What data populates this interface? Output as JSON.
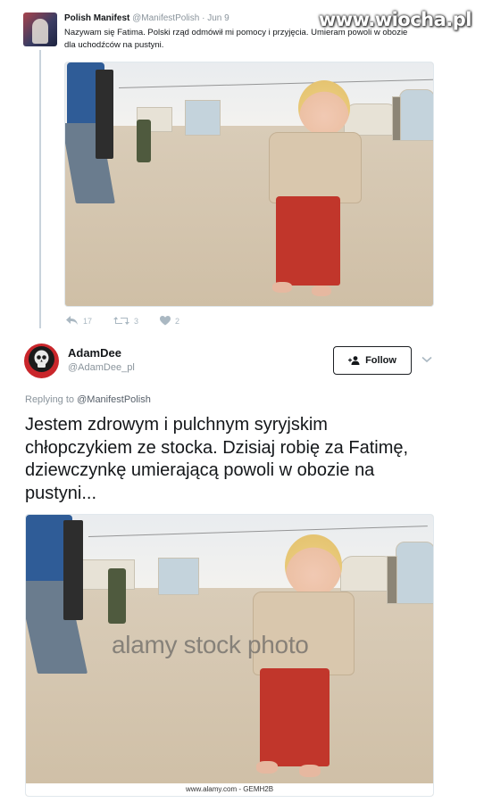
{
  "watermark": "www.wiocha.pl",
  "quoted_tweet": {
    "name": "Polish Manifest",
    "handle": "@ManifestPolish",
    "separator": "·",
    "date": "Jun 9",
    "text": "Nazywam się Fatima. Polski rząd odmówił mi pomocy i przyjęcia. Umieram powoli w obozie dla uchodźców na pustyni.",
    "actions": {
      "reply_count": "17",
      "retweet_count": "3",
      "like_count": "2"
    }
  },
  "main_tweet": {
    "name": "AdamDee",
    "handle": "@AdamDee_pl",
    "follow_label": "Follow",
    "replying_prefix": "Replying to",
    "replying_to": "@ManifestPolish",
    "text": "Jestem zdrowym i pulchnym syryjskim chłopczykiem ze stocka. Dzisiaj robię za Fatimę, dziewczynkę umierającą powoli w obozie na pustyni...",
    "photo": {
      "watermark": "alamy stock photo",
      "credit": "www.alamy.com - GEMH2B"
    }
  },
  "icons": [
    "reply-icon",
    "retweet-icon",
    "heart-icon",
    "follow-person-icon",
    "chevron-down-icon"
  ],
  "colors": {
    "text": "#14171a",
    "secondary": "#8a949c",
    "icon": "#aab8c2",
    "avatar_red": "#c9262b",
    "pants_red": "#c1362b"
  }
}
